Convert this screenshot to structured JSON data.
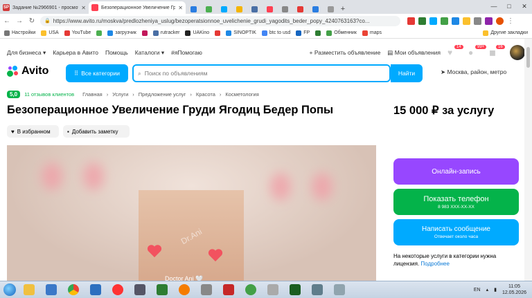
{
  "browser": {
    "tabs": [
      {
        "title": "Задание №2966901 - просмотр з",
        "favicon_text": "SP",
        "color": "#d23b3b"
      },
      {
        "title": "Безоперационное Увеличение Гр",
        "favicon_text": "",
        "color": "#ff4053"
      }
    ],
    "url": "https://www.avito.ru/moskva/predlozheniya_uslug/bezoperatsionnoe_uvelichenie_grudi_yagodits_beder_popy_4240763163?co...",
    "bookmarks": [
      "Настройки",
      "USA",
      "YouTube",
      "загрузчик",
      "rutracker",
      "UAKino",
      "SINOPTIK",
      "btc to usd",
      "FP",
      "Обменник",
      "maps"
    ],
    "other_bookmarks": "Другие закладки"
  },
  "site": {
    "top_links": [
      "Для бизнеса",
      "Карьера в Авито",
      "Помощь",
      "Каталоги",
      "#яПомогаю"
    ],
    "post_ad": "Разместить объявление",
    "my_ads": "Мои объявления",
    "badges": {
      "favorites": "14",
      "messages": "99+",
      "cart": "16"
    },
    "logo": "Avito",
    "all_categories": "Все категории",
    "search_placeholder": "Поиск по объявлениям",
    "find": "Найти",
    "location": "Москва, район, метро"
  },
  "listing": {
    "rating": "5,0",
    "reviews": "11 отзывов клиентов",
    "breadcrumbs": [
      "Главная",
      "Услуги",
      "Предложение услуг",
      "Красота",
      "Косметология"
    ],
    "title": "Безоперационное Увеличение Груди Ягодиц Бедер Попы",
    "price": "15 000 ₽ за услугу",
    "favorite": "В избранном",
    "add_note": "Добавить заметку",
    "photo_caption": "Doctor Ani 🤍",
    "watermark": "Dr.Ani"
  },
  "actions": {
    "online_booking": "Онлайн-запись",
    "show_phone": "Показать телефон",
    "phone": "8 983 XXX-XX-XX",
    "write_message": "Написать сообщение",
    "reply_time": "Отвечает около часа",
    "license_note": "На некоторые услуги в категории нужна лицензия.",
    "more": "Подробнее"
  },
  "taskbar": {
    "lang": "EN",
    "time": "11:05",
    "date": "12.05.2026"
  },
  "colors": {
    "accent": "#00aaff",
    "purple": "#9747ff",
    "green": "#04b34a",
    "blue": "#00aaff"
  }
}
